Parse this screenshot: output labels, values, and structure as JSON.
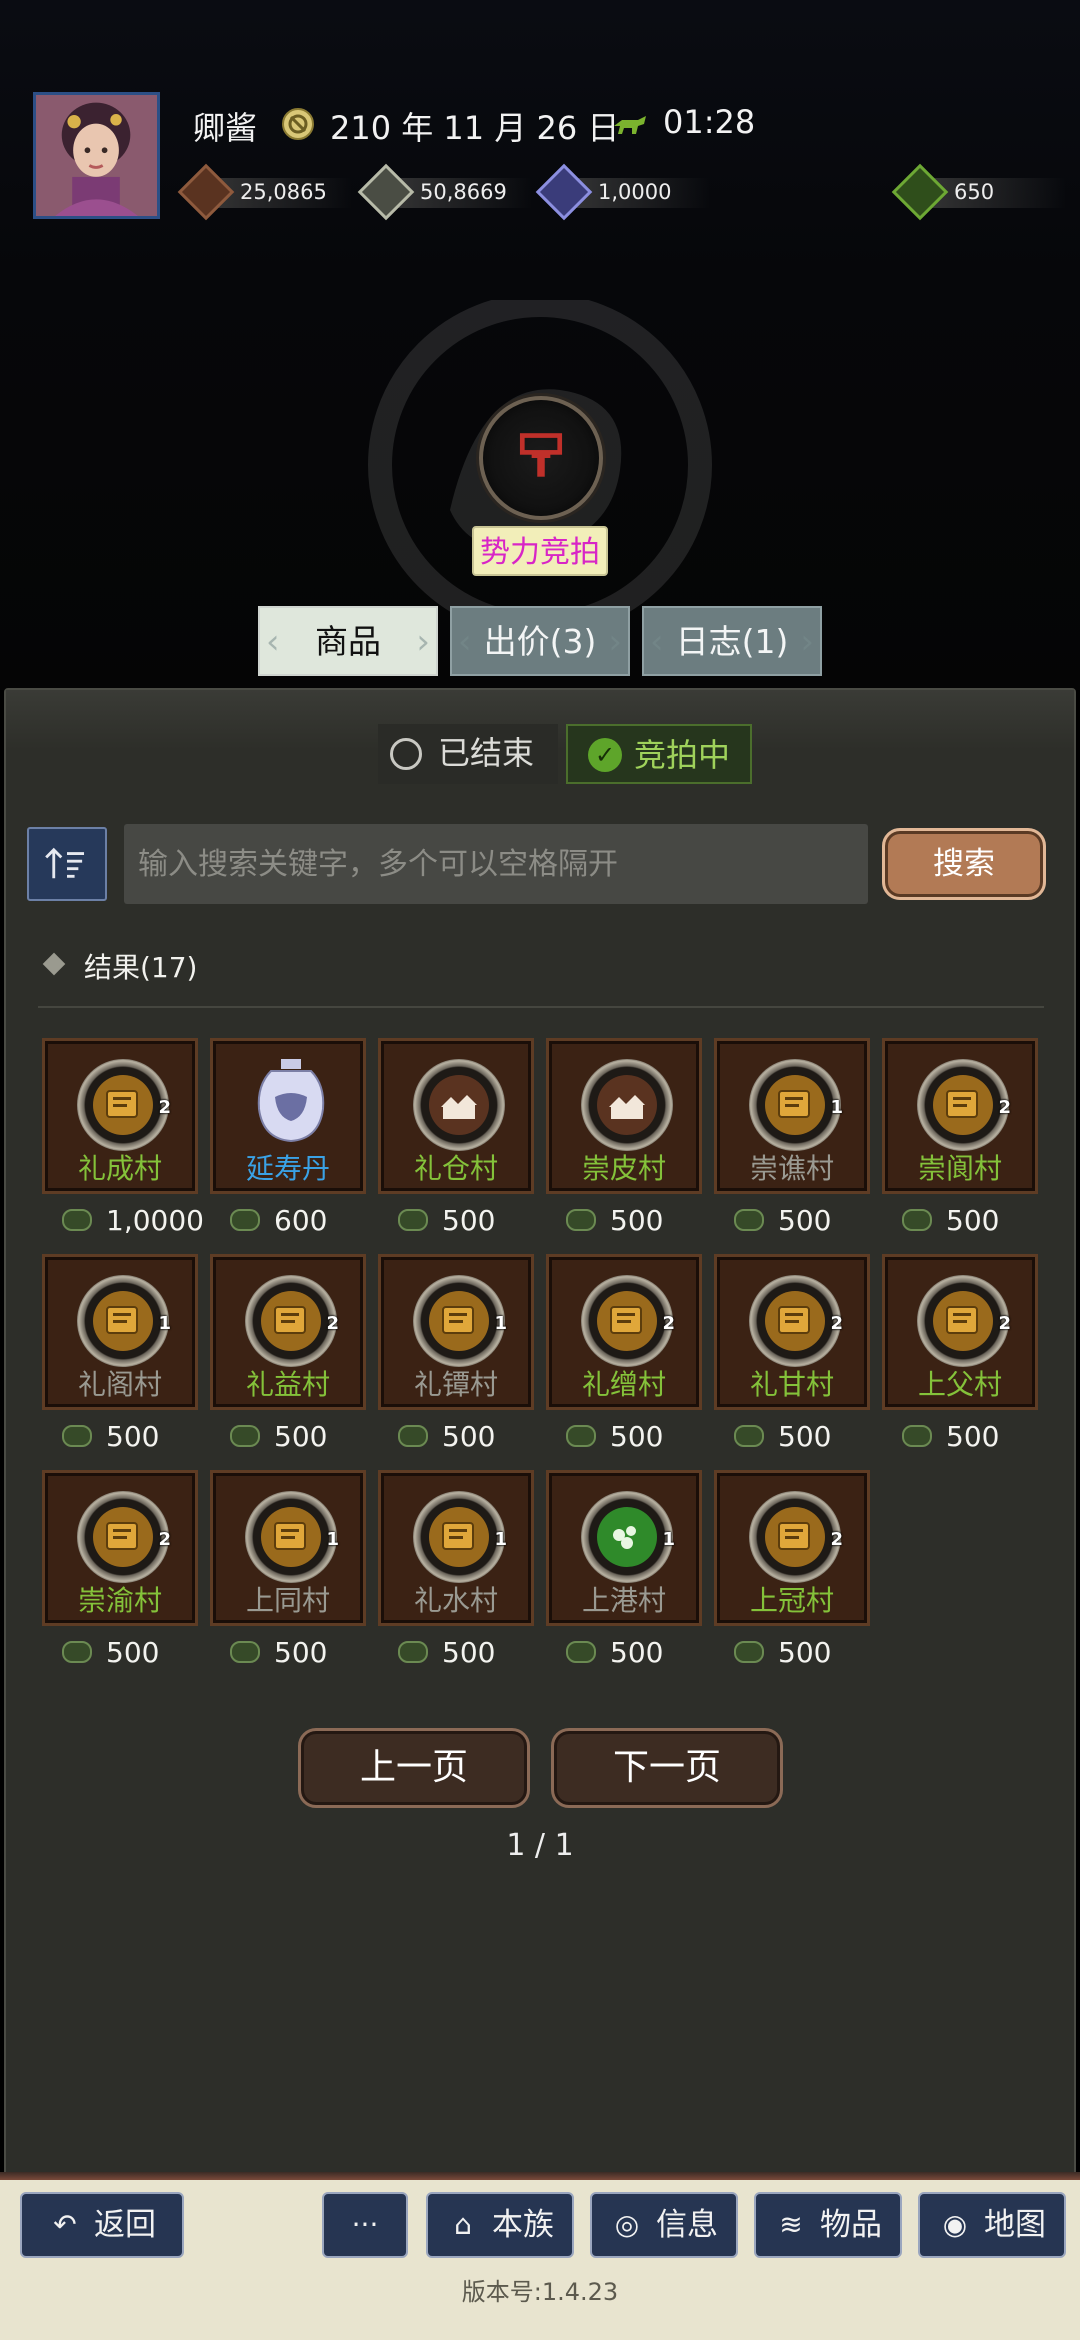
{
  "header": {
    "player_name": "卿酱",
    "date": "210 年 11 月 26 日",
    "time": "01:28",
    "resources": [
      {
        "name": "copper-coins",
        "value": "25,0865",
        "color": "#8e5a3d"
      },
      {
        "name": "silver-ingots",
        "value": "50,8669",
        "color": "#b7baa8"
      },
      {
        "name": "manpower",
        "value": "1,0000",
        "color": "#8c8fe0"
      },
      {
        "name": "provisions",
        "value": "650",
        "color": "#6da834"
      }
    ]
  },
  "auction": {
    "title": "势力竞拍"
  },
  "tabs": [
    {
      "label": "商品",
      "active": true
    },
    {
      "label": "出价(3)",
      "active": false
    },
    {
      "label": "日志(1)",
      "active": false
    }
  ],
  "filters": {
    "ended": "已结束",
    "bidding": "竞拍中",
    "selected": "bidding"
  },
  "search": {
    "placeholder": "输入搜索关键字，多个可以空格隔开",
    "button": "搜索"
  },
  "results_label": "结果(17)",
  "items": [
    {
      "name": "礼成村",
      "price": "1,0000",
      "color": "#84c23a",
      "type": "village",
      "level": "2"
    },
    {
      "name": "延寿丹",
      "price": "600",
      "color": "#3aa2e6",
      "type": "pill",
      "level": ""
    },
    {
      "name": "礼仓村",
      "price": "500",
      "color": "#84c23a",
      "type": "house",
      "level": ""
    },
    {
      "name": "崇皮村",
      "price": "500",
      "color": "#84c23a",
      "type": "house",
      "level": ""
    },
    {
      "name": "崇谯村",
      "price": "500",
      "color": "#9a9a92",
      "type": "village",
      "level": "1"
    },
    {
      "name": "崇阆村",
      "price": "500",
      "color": "#84c23a",
      "type": "village",
      "level": "2"
    },
    {
      "name": "礼阁村",
      "price": "500",
      "color": "#9a9a92",
      "type": "village",
      "level": "1"
    },
    {
      "name": "礼益村",
      "price": "500",
      "color": "#84c23a",
      "type": "village",
      "level": "2"
    },
    {
      "name": "礼镡村",
      "price": "500",
      "color": "#9a9a92",
      "type": "village",
      "level": "1"
    },
    {
      "name": "礼缯村",
      "price": "500",
      "color": "#84c23a",
      "type": "village",
      "level": "2"
    },
    {
      "name": "礼甘村",
      "price": "500",
      "color": "#84c23a",
      "type": "village",
      "level": "2"
    },
    {
      "name": "上父村",
      "price": "500",
      "color": "#84c23a",
      "type": "village",
      "level": "2"
    },
    {
      "name": "崇渝村",
      "price": "500",
      "color": "#84c23a",
      "type": "village",
      "level": "2"
    },
    {
      "name": "上同村",
      "price": "500",
      "color": "#9a9a92",
      "type": "village",
      "level": "1"
    },
    {
      "name": "礼水村",
      "price": "500",
      "color": "#9a9a92",
      "type": "village",
      "level": "1"
    },
    {
      "name": "上港村",
      "price": "500",
      "color": "#9a9a92",
      "type": "herb",
      "level": "1"
    },
    {
      "name": "上冠村",
      "price": "500",
      "color": "#84c23a",
      "type": "village",
      "level": "2"
    }
  ],
  "pagination": {
    "prev": "上一页",
    "next": "下一页",
    "indicator": "1 / 1"
  },
  "bottom_nav": [
    {
      "label": "返回",
      "icon": "return-icon"
    },
    {
      "label": "",
      "icon": "more-icon"
    },
    {
      "label": "本族",
      "icon": "clan-icon"
    },
    {
      "label": "信息",
      "icon": "message-icon"
    },
    {
      "label": "物品",
      "icon": "items-icon"
    },
    {
      "label": "地图",
      "icon": "map-icon"
    }
  ],
  "version": "版本号:1.4.23"
}
